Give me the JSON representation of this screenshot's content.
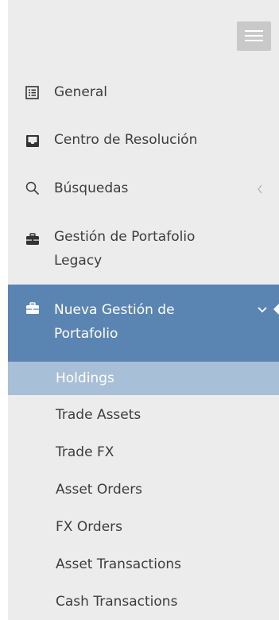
{
  "sidebar": {
    "items": [
      {
        "label": "General",
        "icon": "list-alt-icon"
      },
      {
        "label": "Centro de Resolución",
        "icon": "inbox-icon"
      },
      {
        "label": "Búsquedas",
        "icon": "search-icon"
      },
      {
        "label_line1": "Gestión de Portafolio",
        "label_line2": "Legacy",
        "icon": "briefcase-icon"
      }
    ],
    "active": {
      "label_line1": "Nueva Gestión de",
      "label_line2": "Portafolio",
      "icon": "briefcase-icon"
    },
    "subitems": [
      {
        "label": "Holdings",
        "selected": true
      },
      {
        "label": "Trade Assets"
      },
      {
        "label": "Trade FX"
      },
      {
        "label": "Asset Orders"
      },
      {
        "label": "FX Orders"
      },
      {
        "label": "Asset Transactions"
      },
      {
        "label": "Cash Transactions"
      }
    ]
  },
  "colors": {
    "sidebar_bg": "#ececec",
    "active_bg": "#5a85b2",
    "selected_sub_bg": "#a7c0d8",
    "text": "#3d3d3d"
  }
}
